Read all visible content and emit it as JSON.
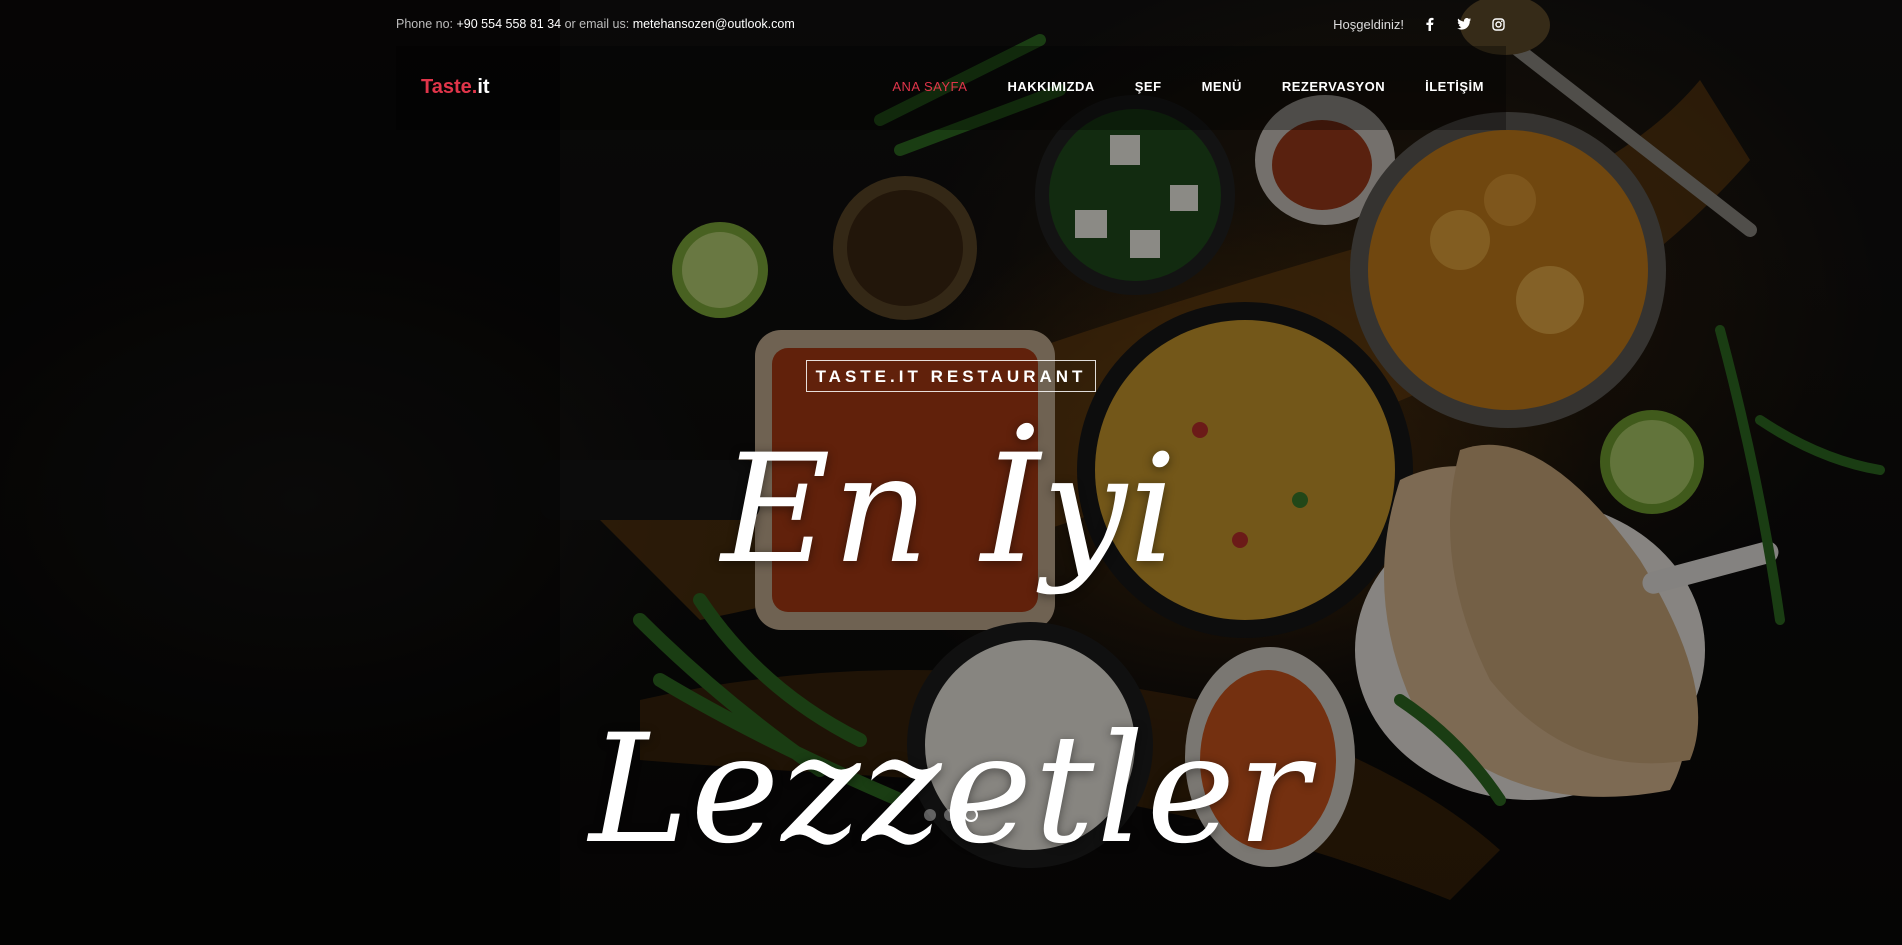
{
  "topbar": {
    "phone_label": "Phone no:",
    "phone_value": "+90 554 558 81 34",
    "email_label": "or email us:",
    "email_value": "metehansozen@outlook.com",
    "welcome": "Hoşgeldiniz!",
    "social_icons": [
      "facebook-icon",
      "twitter-icon",
      "instagram-icon"
    ]
  },
  "brand": {
    "part1": "Taste.",
    "part2": "it",
    "accent_color": "#e0354a"
  },
  "nav": {
    "items": [
      {
        "label": "ANA SAYFA",
        "active": true
      },
      {
        "label": "HAKKIMIZDA",
        "active": false
      },
      {
        "label": "ŞEF",
        "active": false
      },
      {
        "label": "MENÜ",
        "active": false
      },
      {
        "label": "REZERVASYON",
        "active": false
      },
      {
        "label": "İLETİŞİM",
        "active": false
      }
    ]
  },
  "hero": {
    "subtitle": "TASTE.IT RESTAURANT",
    "headline": "En İyi Lezzetler",
    "slides": 3,
    "active_slide": 3
  }
}
